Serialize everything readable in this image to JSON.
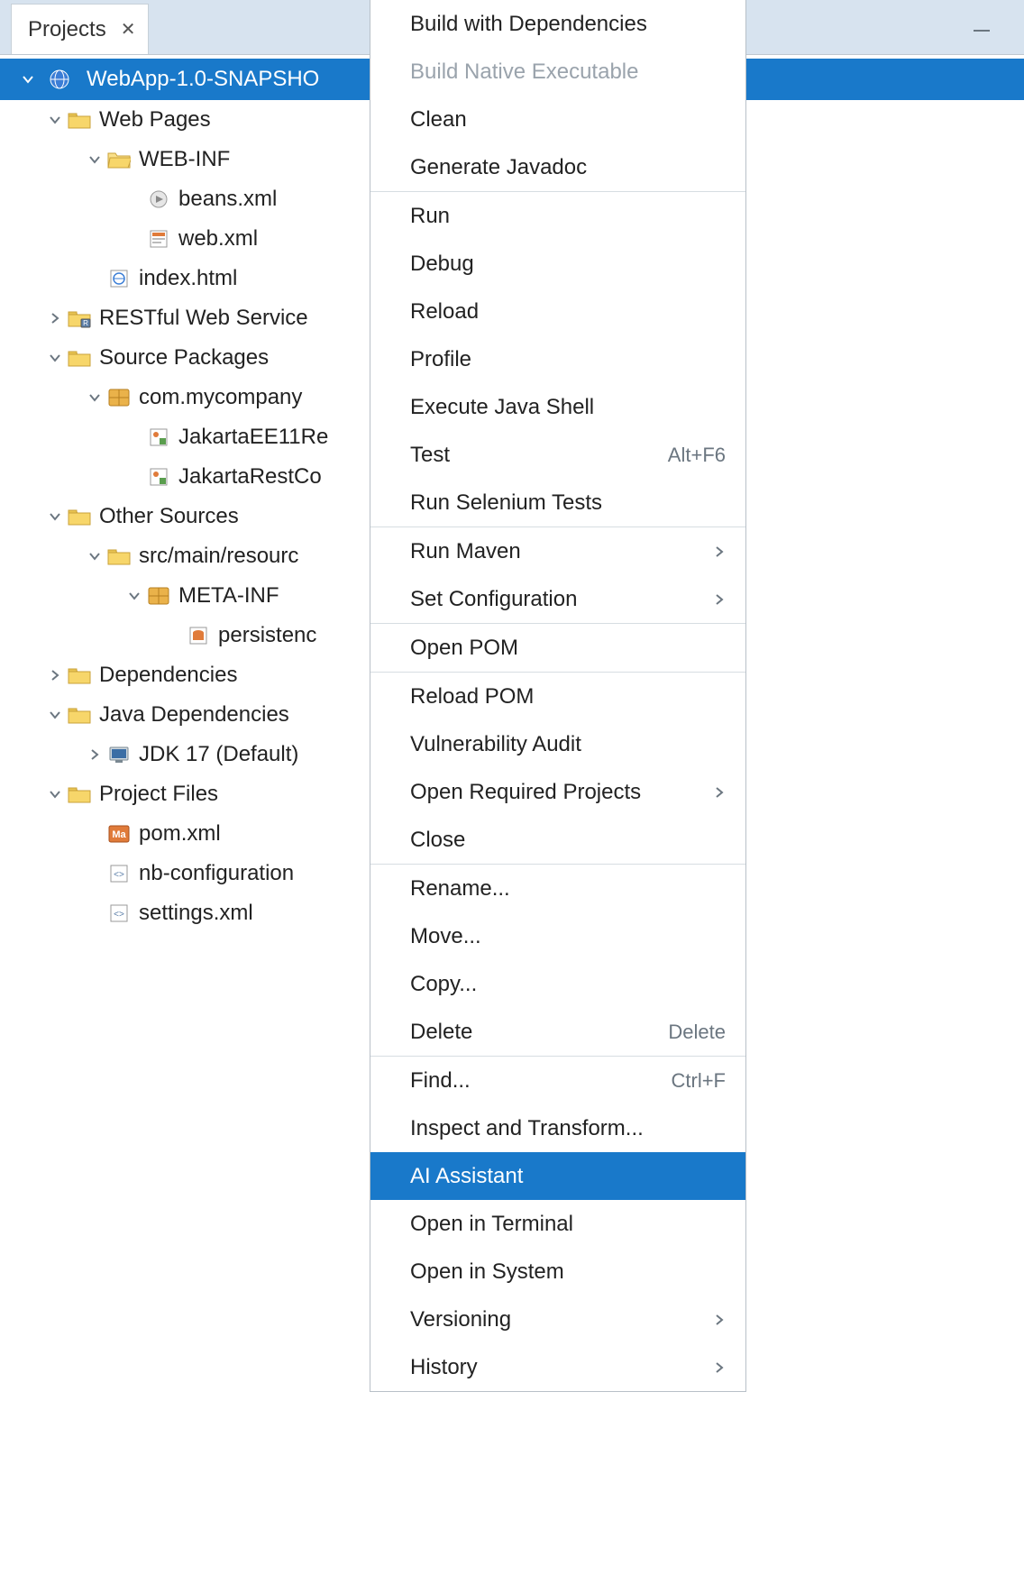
{
  "tab": {
    "title": "Projects"
  },
  "selection": {
    "label": "WebApp-1.0-SNAPSHO"
  },
  "tree": [
    {
      "depth": 0,
      "arrow": "down",
      "icon": "folder-web",
      "label": "Web Pages"
    },
    {
      "depth": 1,
      "arrow": "down",
      "icon": "folder-open",
      "label": "WEB-INF"
    },
    {
      "depth": 2,
      "arrow": "none",
      "icon": "bean",
      "label": "beans.xml"
    },
    {
      "depth": 2,
      "arrow": "none",
      "icon": "webxml",
      "label": "web.xml"
    },
    {
      "depth": 1,
      "arrow": "none",
      "icon": "html",
      "label": "index.html"
    },
    {
      "depth": 0,
      "arrow": "right",
      "icon": "folder-rest",
      "label": "RESTful Web Service"
    },
    {
      "depth": 0,
      "arrow": "down",
      "icon": "folder-pkg",
      "label": "Source Packages"
    },
    {
      "depth": 1,
      "arrow": "down",
      "icon": "package",
      "label": "com.mycompany"
    },
    {
      "depth": 2,
      "arrow": "none",
      "icon": "java",
      "label": "JakartaEE11Re"
    },
    {
      "depth": 2,
      "arrow": "none",
      "icon": "java",
      "label": "JakartaRestCo"
    },
    {
      "depth": 0,
      "arrow": "down",
      "icon": "folder-other",
      "label": "Other Sources"
    },
    {
      "depth": 1,
      "arrow": "down",
      "icon": "folder-other",
      "label": "src/main/resourc"
    },
    {
      "depth": 2,
      "arrow": "down",
      "icon": "package",
      "label": "META-INF"
    },
    {
      "depth": 3,
      "arrow": "none",
      "icon": "persist",
      "label": "persistenc"
    },
    {
      "depth": 0,
      "arrow": "right",
      "icon": "folder-dep",
      "label": "Dependencies"
    },
    {
      "depth": 0,
      "arrow": "down",
      "icon": "folder-dep",
      "label": "Java Dependencies"
    },
    {
      "depth": 1,
      "arrow": "right",
      "icon": "jdk",
      "label": "JDK 17 (Default)"
    },
    {
      "depth": 0,
      "arrow": "down",
      "icon": "folder-proj",
      "label": "Project Files"
    },
    {
      "depth": 1,
      "arrow": "none",
      "icon": "maven",
      "label": "pom.xml"
    },
    {
      "depth": 1,
      "arrow": "none",
      "icon": "xml",
      "label": "nb-configuration"
    },
    {
      "depth": 1,
      "arrow": "none",
      "icon": "xml",
      "label": "settings.xml"
    }
  ],
  "menu": [
    {
      "type": "item",
      "label": "Build with Dependencies"
    },
    {
      "type": "item",
      "label": "Build Native Executable",
      "disabled": true
    },
    {
      "type": "item",
      "label": "Clean"
    },
    {
      "type": "item",
      "label": "Generate Javadoc"
    },
    {
      "type": "sep"
    },
    {
      "type": "item",
      "label": "Run"
    },
    {
      "type": "item",
      "label": "Debug"
    },
    {
      "type": "item",
      "label": "Reload"
    },
    {
      "type": "item",
      "label": "Profile"
    },
    {
      "type": "item",
      "label": "Execute Java Shell"
    },
    {
      "type": "item",
      "label": "Test",
      "shortcut": "Alt+F6"
    },
    {
      "type": "item",
      "label": "Run Selenium Tests"
    },
    {
      "type": "sep"
    },
    {
      "type": "item",
      "label": "Run Maven",
      "submenu": true
    },
    {
      "type": "item",
      "label": "Set Configuration",
      "submenu": true
    },
    {
      "type": "sep"
    },
    {
      "type": "item",
      "label": "Open POM"
    },
    {
      "type": "sep"
    },
    {
      "type": "item",
      "label": "Reload POM"
    },
    {
      "type": "item",
      "label": "Vulnerability Audit"
    },
    {
      "type": "item",
      "label": "Open Required Projects",
      "submenu": true
    },
    {
      "type": "item",
      "label": "Close"
    },
    {
      "type": "sep"
    },
    {
      "type": "item",
      "label": "Rename..."
    },
    {
      "type": "item",
      "label": "Move..."
    },
    {
      "type": "item",
      "label": "Copy..."
    },
    {
      "type": "item",
      "label": "Delete",
      "shortcut": "Delete"
    },
    {
      "type": "sep"
    },
    {
      "type": "item",
      "label": "Find...",
      "shortcut": "Ctrl+F"
    },
    {
      "type": "item",
      "label": "Inspect and Transform..."
    },
    {
      "type": "item",
      "label": "AI Assistant",
      "selected": true
    },
    {
      "type": "item",
      "label": "Open in Terminal"
    },
    {
      "type": "item",
      "label": "Open in System"
    },
    {
      "type": "item",
      "label": "Versioning",
      "submenu": true
    },
    {
      "type": "item",
      "label": "History",
      "submenu": true
    }
  ]
}
